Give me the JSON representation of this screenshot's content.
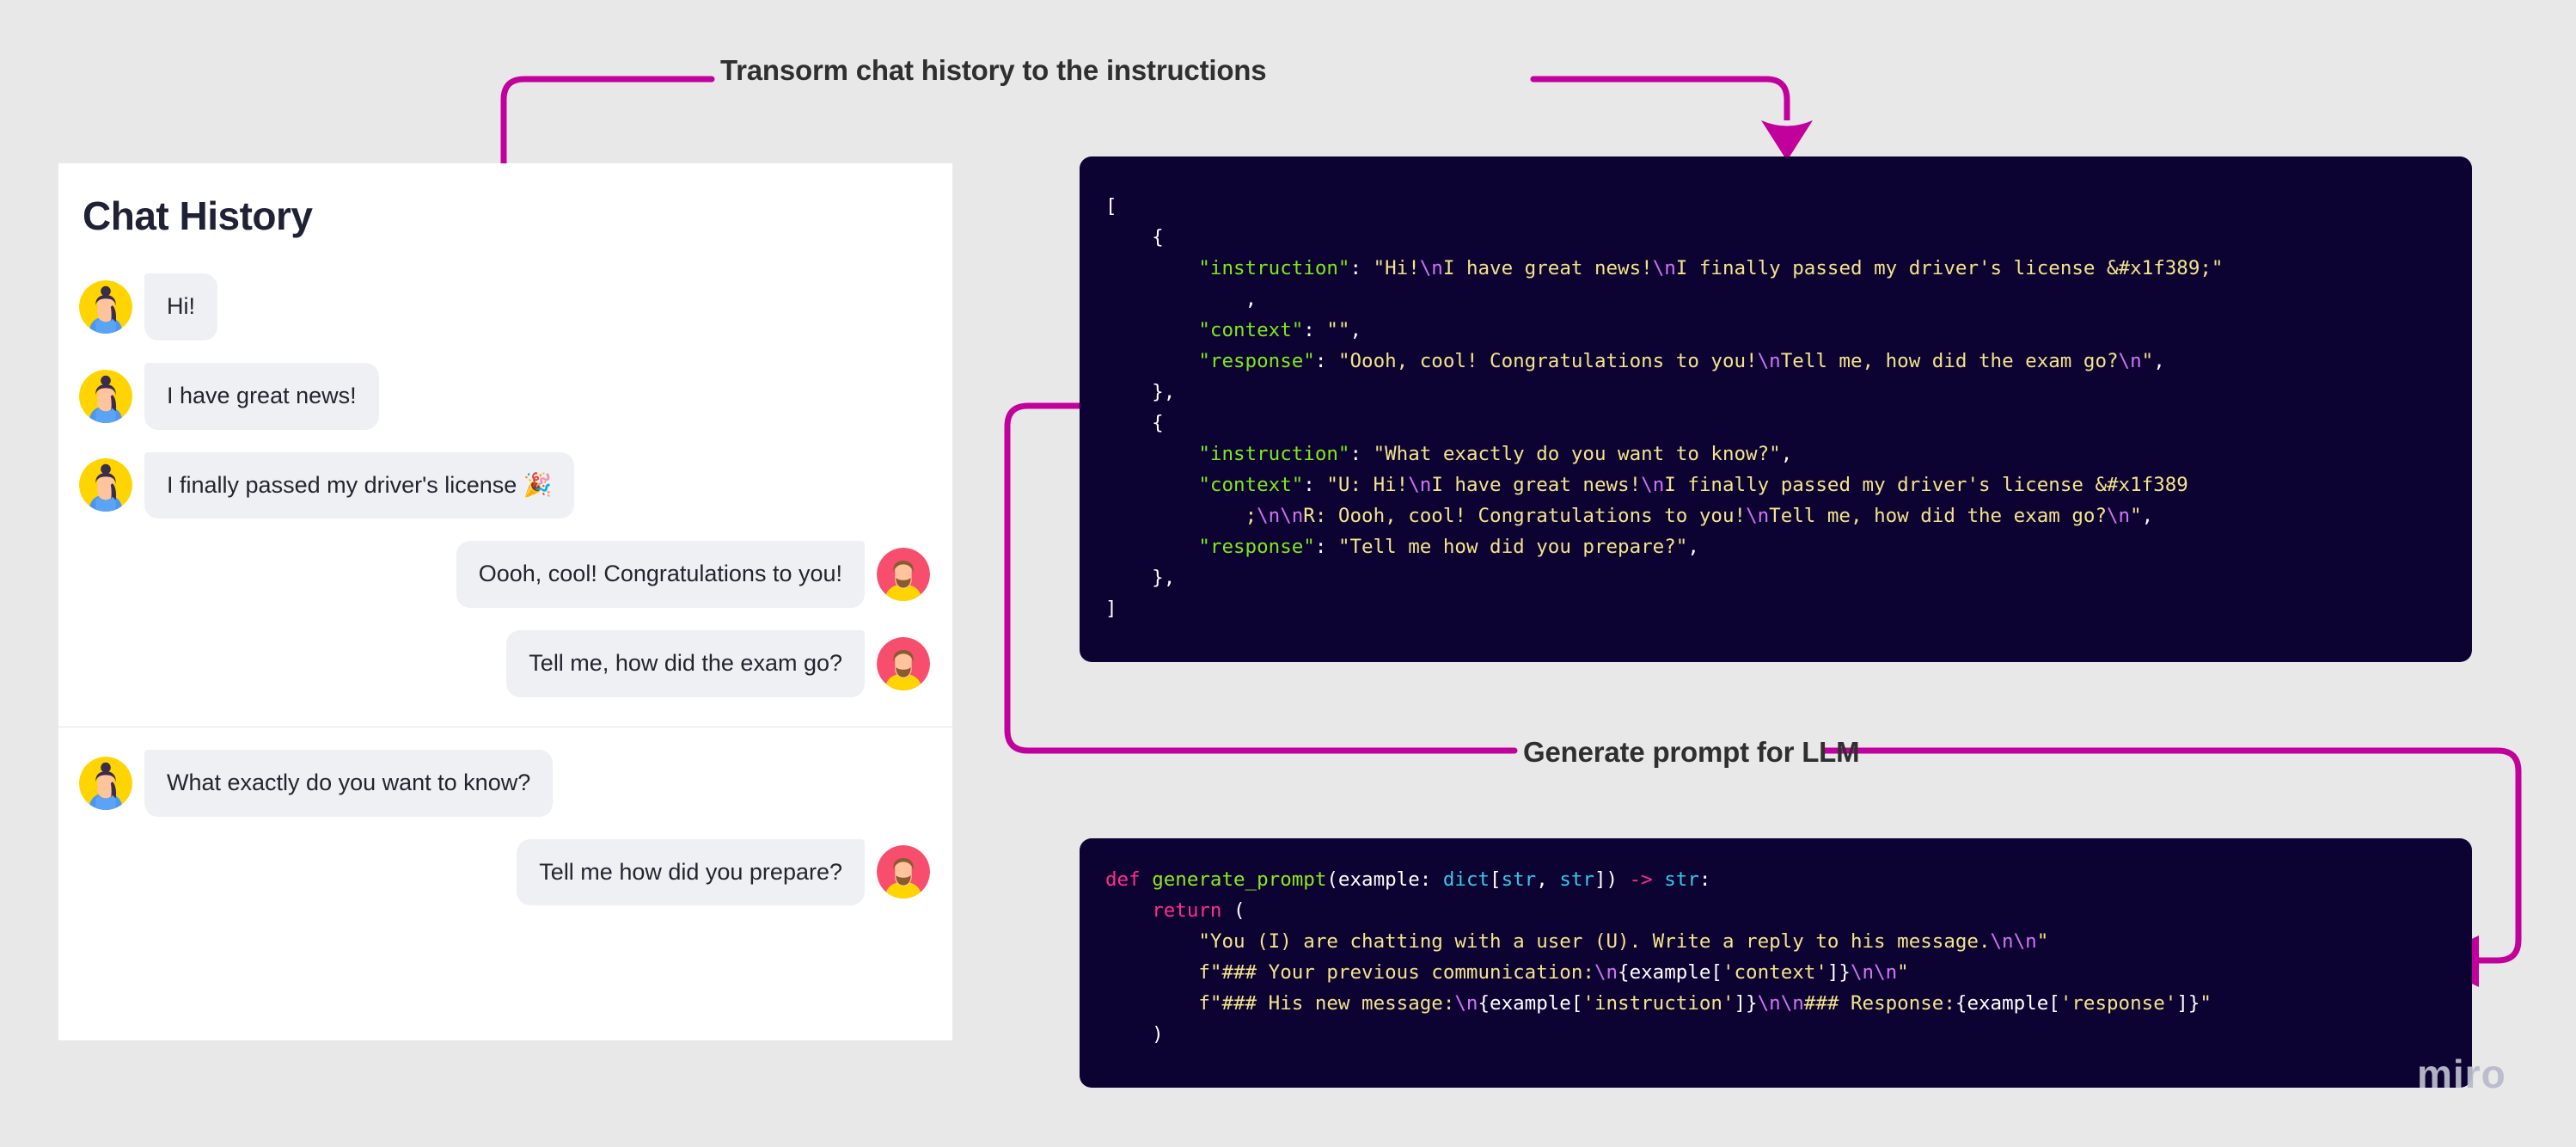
{
  "canvas": {
    "background_color": "#e8e8e8",
    "accent_color": "#c2009c",
    "code_bg_color": "#0d0333"
  },
  "chat_panel": {
    "title": "Chat History",
    "messages": [
      {
        "side": "left",
        "text": "Hi!",
        "avatar": "woman-avatar-icon"
      },
      {
        "side": "left",
        "text": "I have great news!",
        "avatar": "woman-avatar-icon"
      },
      {
        "side": "left",
        "text": "I finally passed my driver's license 🎉",
        "avatar": "woman-avatar-icon"
      },
      {
        "side": "right",
        "text": "Oooh, cool! Congratulations to you!",
        "avatar": "man-avatar-icon"
      },
      {
        "side": "right",
        "text": "Tell me, how did the exam go?",
        "avatar": "man-avatar-icon"
      },
      {
        "side": "left",
        "text": "What exactly do you want to know?",
        "avatar": "woman-avatar-icon"
      },
      {
        "side": "right",
        "text": "Tell me how did you prepare?",
        "avatar": "man-avatar-icon"
      }
    ]
  },
  "connectors": {
    "top_label": "Transorm chat history to the instructions",
    "bottom_label": "Generate prompt for LLM"
  },
  "json_block": {
    "lines": [
      [
        {
          "t": "punct",
          "v": "["
        }
      ],
      [
        {
          "t": "punct",
          "v": "    {"
        }
      ],
      [
        {
          "t": "plain",
          "v": "        "
        },
        {
          "t": "key",
          "v": "\"instruction\""
        },
        {
          "t": "punct",
          "v": ": "
        },
        {
          "t": "str",
          "v": "\"Hi!"
        },
        {
          "t": "esc",
          "v": "\\n"
        },
        {
          "t": "str",
          "v": "I have great news!"
        },
        {
          "t": "esc",
          "v": "\\n"
        },
        {
          "t": "str",
          "v": "I finally passed my driver's license &#x1f389;\""
        }
      ],
      [
        {
          "t": "plain",
          "v": "            "
        },
        {
          "t": "punct",
          "v": ","
        }
      ],
      [
        {
          "t": "plain",
          "v": "        "
        },
        {
          "t": "key",
          "v": "\"context\""
        },
        {
          "t": "punct",
          "v": ": "
        },
        {
          "t": "str",
          "v": "\"\""
        },
        {
          "t": "punct",
          "v": ","
        }
      ],
      [
        {
          "t": "plain",
          "v": "        "
        },
        {
          "t": "key",
          "v": "\"response\""
        },
        {
          "t": "punct",
          "v": ": "
        },
        {
          "t": "str",
          "v": "\"Oooh, cool! Congratulations to you!"
        },
        {
          "t": "esc",
          "v": "\\n"
        },
        {
          "t": "str",
          "v": "Tell me, how did the exam go?"
        },
        {
          "t": "esc",
          "v": "\\n"
        },
        {
          "t": "str",
          "v": "\""
        },
        {
          "t": "punct",
          "v": ","
        }
      ],
      [
        {
          "t": "punct",
          "v": "    },"
        }
      ],
      [
        {
          "t": "punct",
          "v": "    {"
        }
      ],
      [
        {
          "t": "plain",
          "v": "        "
        },
        {
          "t": "key",
          "v": "\"instruction\""
        },
        {
          "t": "punct",
          "v": ": "
        },
        {
          "t": "str",
          "v": "\"What exactly do you want to know?\""
        },
        {
          "t": "punct",
          "v": ","
        }
      ],
      [
        {
          "t": "plain",
          "v": "        "
        },
        {
          "t": "key",
          "v": "\"context\""
        },
        {
          "t": "punct",
          "v": ": "
        },
        {
          "t": "str",
          "v": "\"U: Hi!"
        },
        {
          "t": "esc",
          "v": "\\n"
        },
        {
          "t": "str",
          "v": "I have great news!"
        },
        {
          "t": "esc",
          "v": "\\n"
        },
        {
          "t": "str",
          "v": "I finally passed my driver's license &#x1f389"
        }
      ],
      [
        {
          "t": "plain",
          "v": "            "
        },
        {
          "t": "str",
          "v": ";"
        },
        {
          "t": "esc",
          "v": "\\n\\n"
        },
        {
          "t": "str",
          "v": "R: Oooh, cool! Congratulations to you!"
        },
        {
          "t": "esc",
          "v": "\\n"
        },
        {
          "t": "str",
          "v": "Tell me, how did the exam go?"
        },
        {
          "t": "esc",
          "v": "\\n"
        },
        {
          "t": "str",
          "v": "\""
        },
        {
          "t": "punct",
          "v": ","
        }
      ],
      [
        {
          "t": "plain",
          "v": "        "
        },
        {
          "t": "key",
          "v": "\"response\""
        },
        {
          "t": "punct",
          "v": ": "
        },
        {
          "t": "str",
          "v": "\"Tell me how did you prepare?\""
        },
        {
          "t": "punct",
          "v": ","
        }
      ],
      [
        {
          "t": "punct",
          "v": "    },"
        }
      ],
      [
        {
          "t": "punct",
          "v": "]"
        }
      ]
    ]
  },
  "python_block": {
    "lines": [
      [
        {
          "t": "kw",
          "v": "def "
        },
        {
          "t": "fn",
          "v": "generate_prompt"
        },
        {
          "t": "plain",
          "v": "(example: "
        },
        {
          "t": "type",
          "v": "dict"
        },
        {
          "t": "plain",
          "v": "["
        },
        {
          "t": "type",
          "v": "str"
        },
        {
          "t": "plain",
          "v": ", "
        },
        {
          "t": "type",
          "v": "str"
        },
        {
          "t": "plain",
          "v": "]) "
        },
        {
          "t": "op",
          "v": "-> "
        },
        {
          "t": "type",
          "v": "str"
        },
        {
          "t": "plain",
          "v": ":"
        }
      ],
      [
        {
          "t": "plain",
          "v": "    "
        },
        {
          "t": "kw",
          "v": "return"
        },
        {
          "t": "plain",
          "v": " ("
        }
      ],
      [
        {
          "t": "plain",
          "v": "        "
        },
        {
          "t": "str",
          "v": "\"You (I) are chatting with a user (U). Write a reply to his message."
        },
        {
          "t": "esc",
          "v": "\\n\\n"
        },
        {
          "t": "str",
          "v": "\""
        }
      ],
      [
        {
          "t": "plain",
          "v": "        "
        },
        {
          "t": "str",
          "v": "f\"### Your previous communication:"
        },
        {
          "t": "esc",
          "v": "\\n"
        },
        {
          "t": "plain",
          "v": "{example["
        },
        {
          "t": "str",
          "v": "'context'"
        },
        {
          "t": "plain",
          "v": "]}"
        },
        {
          "t": "esc",
          "v": "\\n\\n"
        },
        {
          "t": "str",
          "v": "\""
        }
      ],
      [
        {
          "t": "plain",
          "v": "        "
        },
        {
          "t": "str",
          "v": "f\"### His new message:"
        },
        {
          "t": "esc",
          "v": "\\n"
        },
        {
          "t": "plain",
          "v": "{example["
        },
        {
          "t": "str",
          "v": "'instruction'"
        },
        {
          "t": "plain",
          "v": "]}"
        },
        {
          "t": "esc",
          "v": "\\n\\n"
        },
        {
          "t": "str",
          "v": "### Response:"
        },
        {
          "t": "plain",
          "v": "{example["
        },
        {
          "t": "str",
          "v": "'response'"
        },
        {
          "t": "plain",
          "v": "]}"
        },
        {
          "t": "str",
          "v": "\""
        }
      ],
      [
        {
          "t": "plain",
          "v": "    )"
        }
      ]
    ]
  },
  "watermark": {
    "text": "miro"
  }
}
